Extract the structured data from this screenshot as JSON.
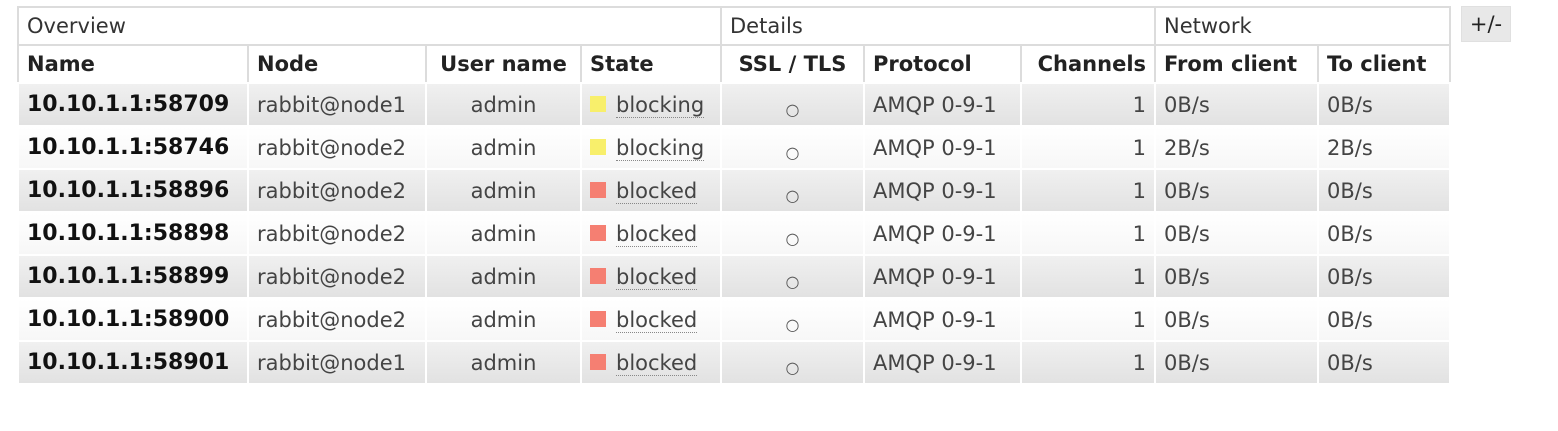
{
  "toggle_label": "+/-",
  "groups": {
    "overview": "Overview",
    "details": "Details",
    "network": "Network"
  },
  "columns": {
    "name": "Name",
    "node": "Node",
    "user": "User name",
    "state": "State",
    "ssl": "SSL / TLS",
    "protocol": "Protocol",
    "channels": "Channels",
    "from_client": "From client",
    "to_client": "To client"
  },
  "state_colors": {
    "blocking": "#f8ef6b",
    "blocked": "#f57f72"
  },
  "rows": [
    {
      "name": "10.10.1.1:58709",
      "node": "rabbit@node1",
      "user": "admin",
      "state": "blocking",
      "ssl": "○",
      "protocol": "AMQP 0-9-1",
      "channels": "1",
      "from_client": "0B/s",
      "to_client": "0B/s"
    },
    {
      "name": "10.10.1.1:58746",
      "node": "rabbit@node2",
      "user": "admin",
      "state": "blocking",
      "ssl": "○",
      "protocol": "AMQP 0-9-1",
      "channels": "1",
      "from_client": "2B/s",
      "to_client": "2B/s"
    },
    {
      "name": "10.10.1.1:58896",
      "node": "rabbit@node2",
      "user": "admin",
      "state": "blocked",
      "ssl": "○",
      "protocol": "AMQP 0-9-1",
      "channels": "1",
      "from_client": "0B/s",
      "to_client": "0B/s"
    },
    {
      "name": "10.10.1.1:58898",
      "node": "rabbit@node2",
      "user": "admin",
      "state": "blocked",
      "ssl": "○",
      "protocol": "AMQP 0-9-1",
      "channels": "1",
      "from_client": "0B/s",
      "to_client": "0B/s"
    },
    {
      "name": "10.10.1.1:58899",
      "node": "rabbit@node2",
      "user": "admin",
      "state": "blocked",
      "ssl": "○",
      "protocol": "AMQP 0-9-1",
      "channels": "1",
      "from_client": "0B/s",
      "to_client": "0B/s"
    },
    {
      "name": "10.10.1.1:58900",
      "node": "rabbit@node2",
      "user": "admin",
      "state": "blocked",
      "ssl": "○",
      "protocol": "AMQP 0-9-1",
      "channels": "1",
      "from_client": "0B/s",
      "to_client": "0B/s"
    },
    {
      "name": "10.10.1.1:58901",
      "node": "rabbit@node1",
      "user": "admin",
      "state": "blocked",
      "ssl": "○",
      "protocol": "AMQP 0-9-1",
      "channels": "1",
      "from_client": "0B/s",
      "to_client": "0B/s"
    }
  ]
}
